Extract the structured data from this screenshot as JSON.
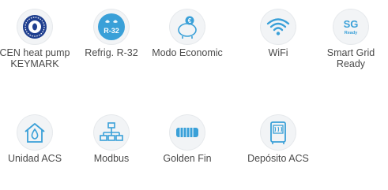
{
  "features": [
    {
      "label": "CEN heat pump KEYMARK",
      "icon": "keymark-icon"
    },
    {
      "label": "Refrig. R-32",
      "icon": "r32-icon",
      "icon_text": "R-32"
    },
    {
      "label": "Modo Economic",
      "icon": "piggy-bank-icon",
      "icon_text": "€"
    },
    {
      "label": "WiFi",
      "icon": "wifi-icon"
    },
    {
      "label": "Smart Grid Ready",
      "icon": "smart-grid-icon",
      "icon_text": "SG",
      "icon_subtext": "Ready"
    },
    {
      "label": "Unidad ACS",
      "icon": "house-water-icon"
    },
    {
      "label": "Modbus",
      "icon": "network-icon"
    },
    {
      "label": "Golden Fin",
      "icon": "golden-fin-icon"
    },
    {
      "label": "Depósito ACS",
      "icon": "water-tank-icon"
    }
  ],
  "colors": {
    "accent": "#3aa0d8",
    "navy": "#1f3f8f",
    "text": "#4a4a4a",
    "circle": "#f2f4f6"
  }
}
